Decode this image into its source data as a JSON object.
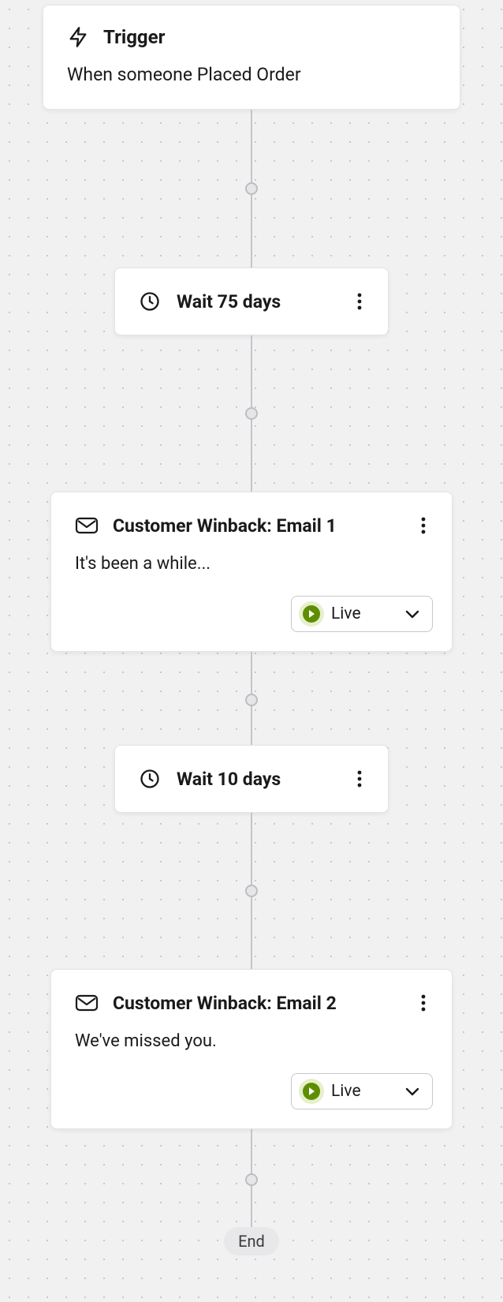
{
  "trigger": {
    "label": "Trigger",
    "description": "When someone Placed Order"
  },
  "steps": {
    "wait1": {
      "label": "Wait 75 days"
    },
    "email1": {
      "title": "Customer Winback: Email 1",
      "subject": "It's been a while...",
      "status": "Live"
    },
    "wait2": {
      "label": "Wait 10 days"
    },
    "email2": {
      "title": "Customer Winback: Email 2",
      "subject": "We've missed you.",
      "status": "Live"
    }
  },
  "end": {
    "label": "End"
  }
}
